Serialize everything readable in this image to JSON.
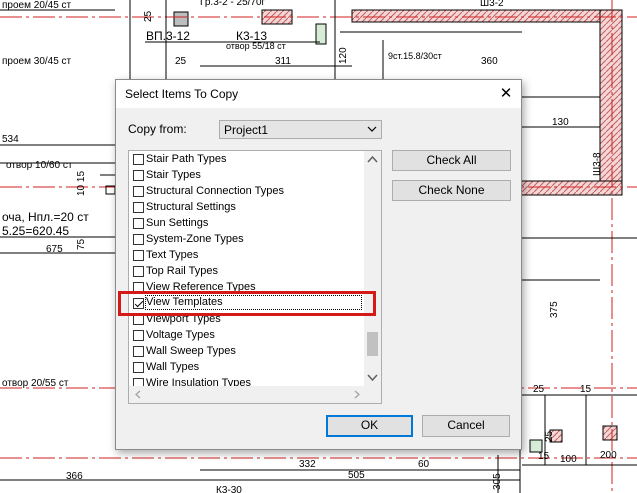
{
  "drawing": {
    "labels": [
      "проем 20/45 ст",
      "проем 30/45 ст",
      "проем 10/60 ст",
      "проем 20/55 ст",
      "ВП.3-12",
      "К3-13",
      "отвор 55/18 ст",
      "Гр.3-2 - 25/70г",
      "9ст.15.8/30ст",
      "Ш3-2",
      "Ш3-8",
      "оча, Нпл.=20 ст",
      "5.25=620.45",
      "534",
      "25",
      "311",
      "120",
      "360",
      "130",
      "10",
      "15",
      "75",
      "675",
      "150",
      "375",
      "305",
      "332",
      "60",
      "505",
      "366",
      "200",
      "100",
      "К3-30"
    ]
  },
  "dialog": {
    "title": "Select Items To Copy",
    "close_glyph": "✕",
    "copy_from_label": "Copy from:",
    "copy_from_value": "Project1",
    "items": [
      {
        "label": "Stair Path Types",
        "checked": false
      },
      {
        "label": "Stair Types",
        "checked": false
      },
      {
        "label": "Structural Connection Types",
        "checked": false
      },
      {
        "label": "Structural Settings",
        "checked": false
      },
      {
        "label": "Sun Settings",
        "checked": false
      },
      {
        "label": "System-Zone Types",
        "checked": false
      },
      {
        "label": "Text Types",
        "checked": false
      },
      {
        "label": "Top Rail Types",
        "checked": false
      },
      {
        "label": "View Reference Types",
        "checked": false
      },
      {
        "label": "View Templates",
        "checked": true
      },
      {
        "label": "Viewport Types",
        "checked": false
      },
      {
        "label": "Voltage Types",
        "checked": false
      },
      {
        "label": "Wall Sweep Types",
        "checked": false
      },
      {
        "label": "Wall Types",
        "checked": false
      },
      {
        "label": "Wire Insulation Types",
        "checked": false
      }
    ],
    "check_all_label": "Check All",
    "check_none_label": "Check None",
    "ok_label": "OK",
    "cancel_label": "Cancel"
  },
  "colors": {
    "highlight": "#d51818",
    "hatch": "#e8a8a8",
    "accent": "#0078d7"
  }
}
